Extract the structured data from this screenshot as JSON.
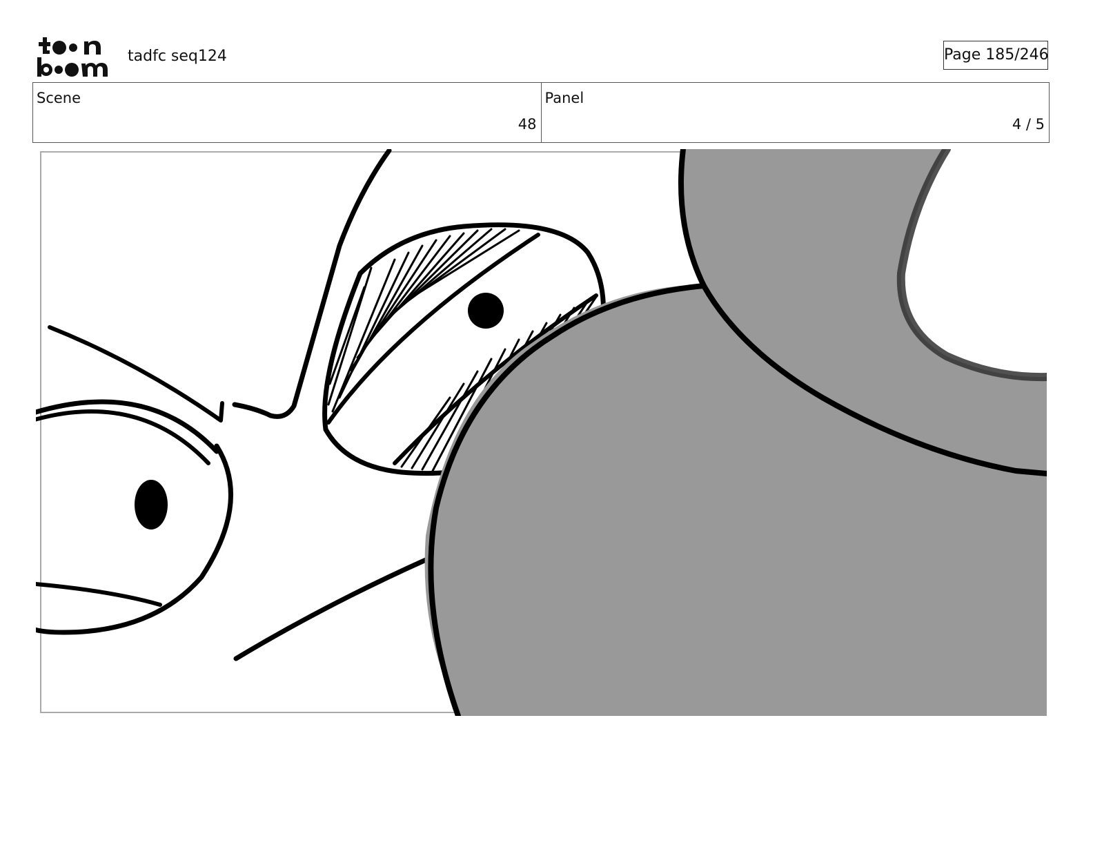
{
  "header": {
    "logo_text": "toon boom",
    "title": "tadfc seq124",
    "page_label": "Page 185/246"
  },
  "info": {
    "scene_label": "Scene",
    "scene_value": "48",
    "panel_label": "Panel",
    "panel_value": "4 / 5"
  },
  "panel_image": {
    "fill_color": "#999999",
    "ink_color": "#000000"
  }
}
